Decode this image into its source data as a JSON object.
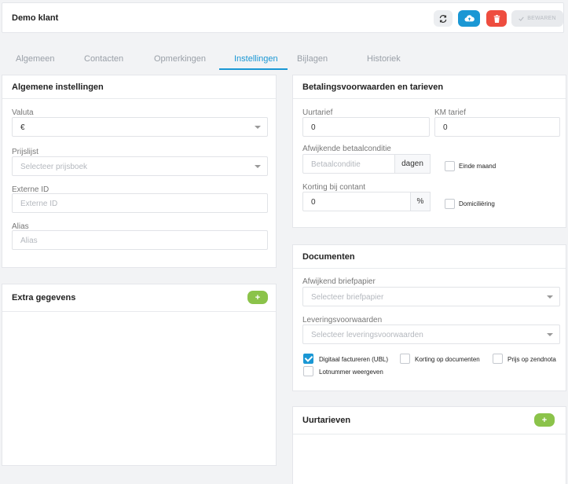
{
  "header": {
    "title": "Demo klant",
    "save_label": "BEWAREN"
  },
  "tabs": [
    {
      "label": "Algemeen"
    },
    {
      "label": "Contacten"
    },
    {
      "label": "Opmerkingen"
    },
    {
      "label": "Instellingen",
      "active": true
    },
    {
      "label": "Bijlagen"
    },
    {
      "label": "Historiek"
    }
  ],
  "general": {
    "title": "Algemene instellingen",
    "currency_label": "Valuta",
    "currency_value": "€",
    "pricelist_label": "Prijslijst",
    "pricelist_placeholder": "Selecteer prijsboek",
    "external_id_label": "Externe ID",
    "external_id_placeholder": "Externe ID",
    "alias_label": "Alias",
    "alias_placeholder": "Alias"
  },
  "extra": {
    "title": "Extra gegevens",
    "add_label": "+"
  },
  "payment": {
    "title": "Betalingsvoorwaarden en tarieven",
    "hourly_label": "Uurtarief",
    "hourly_value": "0",
    "km_label": "KM tarief",
    "km_value": "0",
    "condition_label": "Afwijkende betaalconditie",
    "condition_placeholder": "Betaalconditie",
    "condition_unit": "dagen",
    "end_of_month_label": "Einde maand",
    "cash_discount_label": "Korting bij contant",
    "cash_discount_value": "0",
    "cash_discount_unit": "%",
    "direct_debit_label": "Domiciliëring"
  },
  "documents": {
    "title": "Documenten",
    "letterhead_label": "Afwijkend briefpapier",
    "letterhead_placeholder": "Selecteer briefpapier",
    "delivery_label": "Leveringsvoorwaarden",
    "delivery_placeholder": "Selecteer leveringsvoorwaarden",
    "ubl_label": "Digitaal factureren (UBL)",
    "discount_docs_label": "Korting op documenten",
    "price_delivery_label": "Prijs op zendnota",
    "lot_label": "Lotnummer weergeven"
  },
  "hourly_rates": {
    "title": "Uurtarieven",
    "add_label": "+"
  },
  "colors": {
    "accent": "#1a97d4",
    "danger": "#ee4d3f",
    "success": "#8bc34a"
  },
  "icons": [
    "refresh-icon",
    "cloud-upload-icon",
    "trash-icon",
    "check-icon",
    "chevron-down-icon"
  ]
}
